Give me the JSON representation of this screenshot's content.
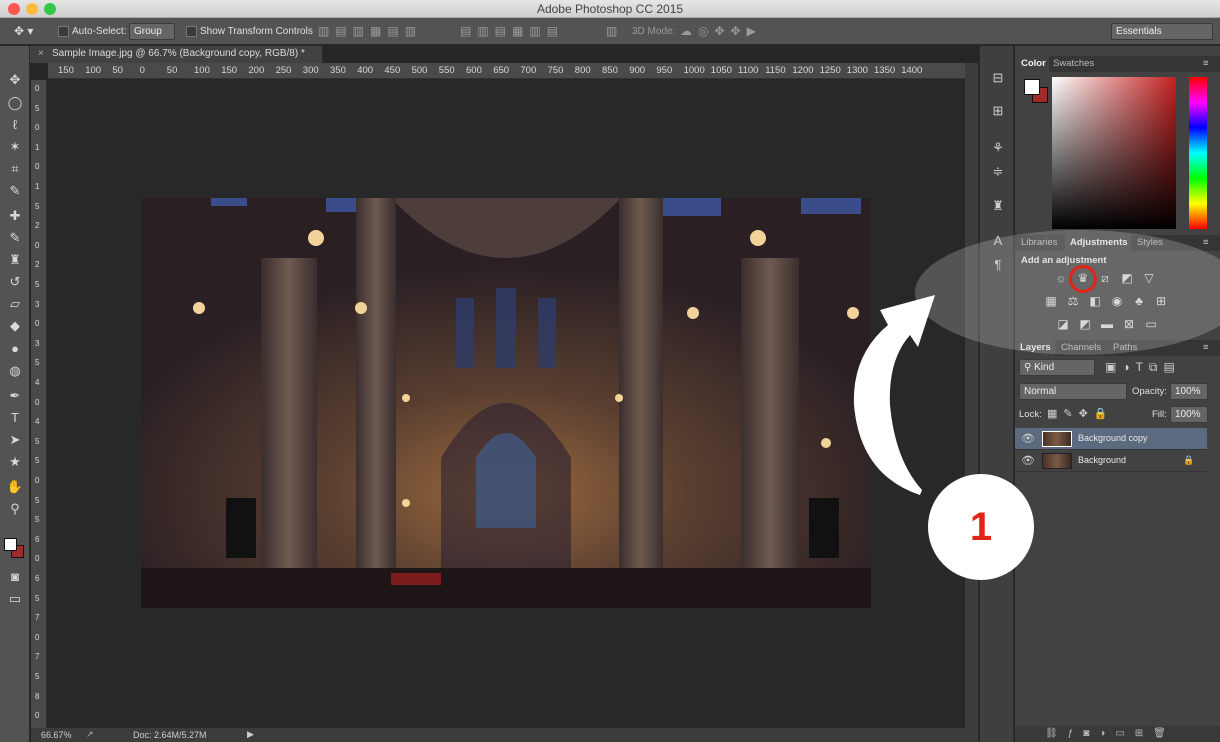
{
  "app_title": "Adobe Photoshop CC 2015",
  "options_bar": {
    "auto_select_label": "Auto-Select:",
    "auto_select_value": "Group",
    "transform_label": "Show Transform Controls",
    "mode_3d_label": "3D Mode:",
    "workspace": "Essentials"
  },
  "document": {
    "tab_title": "Sample Image.jpg @ 66.7% (Background copy, RGB/8) *",
    "ruler_h": [
      "150",
      "100",
      "50",
      "0",
      "50",
      "100",
      "150",
      "200",
      "250",
      "300",
      "350",
      "400",
      "450",
      "500",
      "550",
      "600",
      "650",
      "700",
      "750",
      "800",
      "850",
      "900",
      "950",
      "1000",
      "1050",
      "1100",
      "1150",
      "1200",
      "1250",
      "1300",
      "1350",
      "1400"
    ],
    "ruler_v": [
      "0",
      "5",
      "0",
      "1",
      "0",
      "1",
      "5",
      "2",
      "0",
      "2",
      "5",
      "3",
      "0",
      "3",
      "5",
      "4",
      "0",
      "4",
      "5",
      "5",
      "0",
      "5",
      "5",
      "6",
      "0",
      "6",
      "5",
      "7",
      "0",
      "7",
      "5",
      "8",
      "0"
    ]
  },
  "status": {
    "zoom": "66.67%",
    "doc": "Doc: 2.64M/5.27M"
  },
  "color_panel": {
    "tabs": [
      "Color",
      "Swatches"
    ],
    "fg_color": "#ffffff",
    "bg_color": "#a12a2a",
    "hue_color": "#c42020"
  },
  "adjustments_panel": {
    "tabs": [
      "Libraries",
      "Adjustments",
      "Styles"
    ],
    "heading": "Add an adjustment"
  },
  "layers_panel": {
    "tabs": [
      "Layers",
      "Channels",
      "Paths"
    ],
    "filter": "Kind",
    "blend_mode": "Normal",
    "opacity_label": "Opacity:",
    "opacity": "100%",
    "lock_label": "Lock:",
    "fill_label": "Fill:",
    "fill": "100%",
    "layers": [
      {
        "name": "Background copy"
      },
      {
        "name": "Background"
      }
    ]
  },
  "annotation": {
    "step": "1"
  }
}
